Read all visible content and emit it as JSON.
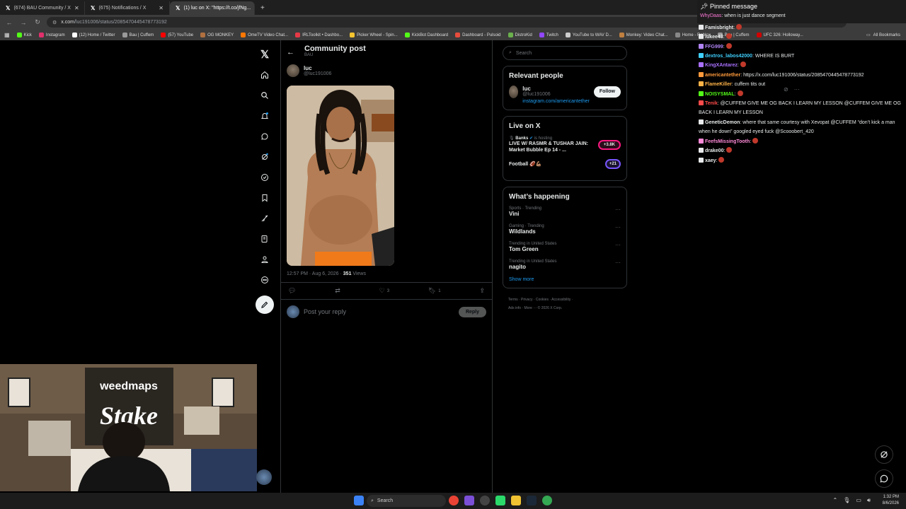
{
  "tabs": [
    {
      "title": "(674) BAU Community / X",
      "active": false
    },
    {
      "title": "(675) Notifications / X",
      "active": false
    },
    {
      "title": "(1) luc on X: \"https://t.co/jfNg...",
      "active": true
    }
  ],
  "new_tab": "+",
  "address": {
    "url_host": "x.com",
    "url_path": "/luc191006/status/2085470445478773192"
  },
  "bookmarks": [
    {
      "label": "Kick",
      "color": "#53fc18"
    },
    {
      "label": "Instagram",
      "color": "#e1306c"
    },
    {
      "label": "(12) Home / Twitter",
      "color": "#ffffff"
    },
    {
      "label": "Bau | Cuffem",
      "color": "#999999"
    },
    {
      "label": "(57) YouTube",
      "color": "#ff0000"
    },
    {
      "label": "OG MONKEY",
      "color": "#b07040"
    },
    {
      "label": "OmeTV Video Chat...",
      "color": "#ff7700"
    },
    {
      "label": "IRLToolkit • Dashbo...",
      "color": "#e63946"
    },
    {
      "label": "Picker Wheel - Spin...",
      "color": "#f4c430"
    },
    {
      "label": "KickBot Dashboard",
      "color": "#53fc18"
    },
    {
      "label": "Dashboard - Pulsoid",
      "color": "#e74c3c"
    },
    {
      "label": "DistroKid",
      "color": "#6ab04c"
    },
    {
      "label": "Twitch",
      "color": "#9146ff"
    },
    {
      "label": "YouTube to WAV D...",
      "color": "#cccccc"
    },
    {
      "label": "Monkey: Video Chat...",
      "color": "#c08040"
    },
    {
      "label": "Home - Roblox",
      "color": "#888888"
    },
    {
      "label": "Bau | Cuffem",
      "color": "#999999"
    },
    {
      "label": "UFC 326: Holloway...",
      "color": "#d00000"
    }
  ],
  "all_bookmarks": "All Bookmarks",
  "nav_icons": [
    "x-logo-icon",
    "home-icon",
    "search-icon",
    "notifications-icon",
    "messages-icon",
    "grok-icon",
    "communities-icon",
    "bookmarks-icon",
    "premium-icon",
    "lists-icon",
    "profile-icon",
    "more-icon"
  ],
  "post": {
    "header_title": "Community post",
    "header_sub": "BAU",
    "author_name": "luc",
    "author_handle": "@luc191006",
    "timestamp": "12:57 PM · Aug 6, 2026 · ",
    "views_count": "351",
    "views_label": " Views",
    "likes": "3",
    "bookmarks": "1",
    "reply_placeholder": "Post your reply",
    "reply_button": "Reply"
  },
  "sidebar": {
    "search_placeholder": "Search",
    "relevant_title": "Relevant people",
    "relevant": {
      "name": "luc",
      "handle": "@luc191006",
      "bio": "instagram.com/americantether",
      "follow": "Follow"
    },
    "live_title": "Live on X",
    "live": [
      {
        "host": "Banks",
        "host_suffix": " is hosting",
        "title": "LIVE W/ RASMR & TUSHAR JAIN: Market Bubble Ep 14 - ...",
        "badge": "+3.8K"
      },
      {
        "host": "",
        "host_suffix": "",
        "title": "Football 🏈💪🏽",
        "badge": "+21"
      }
    ],
    "happening_title": "What’s happening",
    "trends": [
      {
        "context": "Sports · Trending",
        "topic": "Vini"
      },
      {
        "context": "Gaming · Trending",
        "topic": "Wildlands"
      },
      {
        "context": "Trending in United States",
        "topic": "Tom Green"
      },
      {
        "context": "Trending in United States",
        "topic": "nagito"
      }
    ],
    "show_more": "Show more",
    "footer_1": "Terms · Privacy · Cookies · Accessibility ·",
    "footer_2": "Ads info · More ··· © 2026 X Corp."
  },
  "chat": {
    "pinned_title": "Pinned message",
    "pinned_user": "WhyDaas",
    "pinned_text": "when is just dance segment",
    "messages": [
      {
        "user": "Famisbright",
        "color": "#e7e9ea",
        "text": ""
      },
      {
        "user": "lukee43",
        "color": "#e7e9ea",
        "text": ""
      },
      {
        "user": "FFG999",
        "color": "#b084f5",
        "text": ""
      },
      {
        "user": "dextros_labos42000",
        "color": "#3fd0ff",
        "text": "WHERE IS BURT"
      },
      {
        "user": "KingXAntarez",
        "color": "#a970ff",
        "text": ""
      },
      {
        "user": "americantether",
        "color": "#ff9a3c",
        "text": "https://x.com/luc191006/status/2085470445478773192"
      },
      {
        "user": "FlameKiller",
        "color": "#ffb347",
        "text": "cuffem tits out"
      },
      {
        "user": "NOISYSMAL",
        "color": "#53fc18",
        "text": ""
      },
      {
        "user": "Tenik",
        "color": "#ff4b4b",
        "text": "@CUFFEM GIVE ME OG BACK I LEARN MY LESSON @CUFFEM GIVE ME OG BACK I LEARN MY LESSON"
      },
      {
        "user": "GeneticDemon",
        "color": "#e7e9ea",
        "text": "where that same courtesy with Xevopat @CUFFEM “don’t kick a man when he down” googled eyed fuck @Scooobert_420"
      },
      {
        "user": "FeefsMissingTooth",
        "color": "#ff8ad8",
        "text": ""
      },
      {
        "user": "drake00",
        "color": "#e7e9ea",
        "text": ""
      },
      {
        "user": "xaey",
        "color": "#e7e9ea",
        "text": ""
      }
    ]
  },
  "taskbar": {
    "search": "Search",
    "time": "1:32 PM",
    "date": "8/6/2026"
  },
  "colors": {
    "accent": "#1d9bf0",
    "bg": "#000000",
    "border": "#2f3336",
    "muted": "#71767b"
  }
}
